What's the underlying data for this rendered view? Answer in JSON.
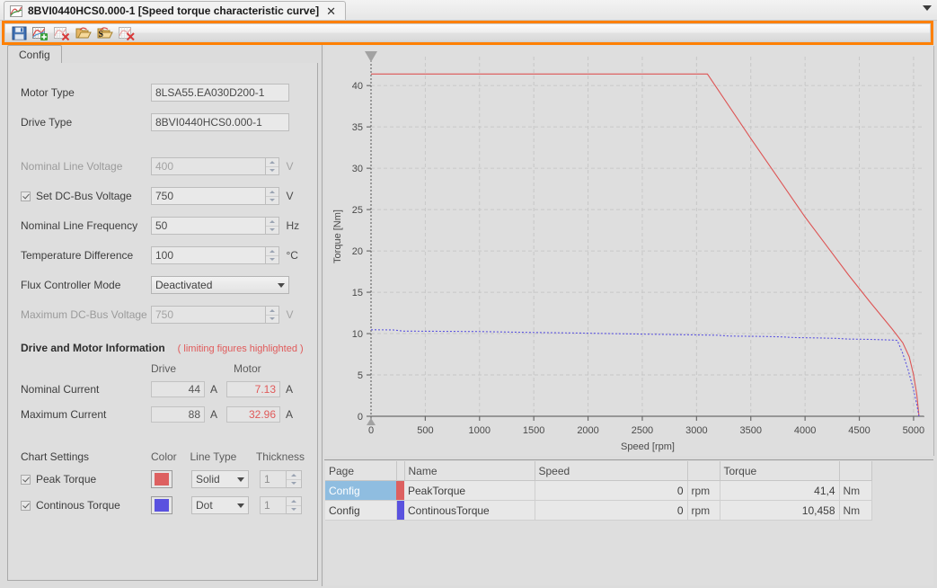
{
  "window": {
    "tab_title": "8BVI0440HCS0.000-1 [Speed torque characteristic curve]",
    "close_label": "✕",
    "tab_icon": "chart-curve-icon",
    "dropdown_icon": "chevron-down-icon",
    "accent_color": "#ff8000"
  },
  "toolbar": {
    "buttons": [
      {
        "name": "save-button",
        "icon": "floppy-disk-icon",
        "tooltip": "Save"
      },
      {
        "name": "add-curve-button",
        "icon": "chart-add-icon",
        "tooltip": "Add curve"
      },
      {
        "name": "delete-curve-button",
        "icon": "chart-delete-icon",
        "tooltip": "Delete curve"
      },
      {
        "name": "open-button",
        "icon": "open-folder-icon",
        "tooltip": "Open"
      },
      {
        "name": "save-as-button",
        "icon": "save-as-icon",
        "tooltip": "Save as"
      },
      {
        "name": "clear-chart-button",
        "icon": "chart-clear-icon",
        "tooltip": "Clear chart"
      }
    ]
  },
  "left_panel": {
    "tab_label": "Config",
    "fields": [
      {
        "label": "Motor Type",
        "value": "8LSA55.EA030D200-1",
        "type": "text",
        "unit": "",
        "disabled": false
      },
      {
        "label": "Drive Type",
        "value": "8BVI0440HCS0.000-1",
        "type": "text",
        "unit": "",
        "disabled": false
      },
      {
        "label": "Nominal Line Voltage",
        "value": "400",
        "type": "spinner",
        "unit": "V",
        "disabled": true
      },
      {
        "label": "Set DC-Bus Voltage",
        "value": "750",
        "type": "spinner",
        "unit": "V",
        "disabled": false,
        "checkbox": true,
        "checked": true
      },
      {
        "label": "Nominal Line Frequency",
        "value": "50",
        "type": "spinner",
        "unit": "Hz",
        "disabled": false
      },
      {
        "label": "Temperature Difference",
        "value": "100",
        "type": "spinner",
        "unit": "°C",
        "disabled": false
      },
      {
        "label": "Flux Controller Mode",
        "value": "Deactivated",
        "type": "select",
        "unit": "",
        "disabled": false
      },
      {
        "label": "Maximum DC-Bus Voltage",
        "value": "750",
        "type": "spinner",
        "unit": "V",
        "disabled": true
      }
    ],
    "info": {
      "title": "Drive and Motor Information",
      "note": "( limiting figures highlighted )",
      "col_drive": "Drive",
      "col_motor": "Motor",
      "rows": [
        {
          "label": "Nominal Current",
          "drive": "44",
          "drive_unit": "A",
          "motor": "7.13",
          "motor_unit": "A",
          "motor_highlight": true
        },
        {
          "label": "Maximum Current",
          "drive": "88",
          "drive_unit": "A",
          "motor": "32.96",
          "motor_unit": "A",
          "motor_highlight": true
        }
      ]
    },
    "chart_settings": {
      "title": "Chart Settings",
      "col_color": "Color",
      "col_linetype": "Line Type",
      "col_thickness": "Thickness",
      "rows": [
        {
          "label": "Peak Torque",
          "checked": true,
          "color": "#dd6060",
          "line_type": "Solid",
          "thickness": "1"
        },
        {
          "label": "Continous Torque",
          "checked": true,
          "color": "#5a52df",
          "line_type": "Dot",
          "thickness": "1"
        }
      ]
    }
  },
  "chart_data": {
    "type": "line",
    "title": "",
    "xlabel": "Speed [rpm]",
    "ylabel": "Torque [Nm]",
    "xlim": [
      0,
      5100
    ],
    "ylim": [
      0,
      43.5
    ],
    "xticks": [
      0,
      500,
      1000,
      1500,
      2000,
      2500,
      3000,
      3500,
      4000,
      4500,
      5000
    ],
    "yticks": [
      0,
      5,
      10,
      15,
      20,
      25,
      30,
      35,
      40
    ],
    "grid": true,
    "legend": "none",
    "series": [
      {
        "name": "PeakTorque",
        "color": "#dd5555",
        "style": "solid",
        "width": 1,
        "points": [
          [
            0,
            41.4
          ],
          [
            500,
            41.4
          ],
          [
            1000,
            41.4
          ],
          [
            1500,
            41.4
          ],
          [
            2000,
            41.4
          ],
          [
            2500,
            41.4
          ],
          [
            3000,
            41.4
          ],
          [
            3100,
            41.4
          ],
          [
            3300,
            37.5
          ],
          [
            3500,
            33.6
          ],
          [
            3700,
            29.8
          ],
          [
            3900,
            26.0
          ],
          [
            4000,
            24.1
          ],
          [
            4200,
            20.6
          ],
          [
            4400,
            17.1
          ],
          [
            4600,
            13.8
          ],
          [
            4800,
            10.6
          ],
          [
            4900,
            8.9
          ],
          [
            4960,
            7.2
          ],
          [
            5000,
            5.0
          ],
          [
            5030,
            2.6
          ],
          [
            5050,
            0.0
          ]
        ]
      },
      {
        "name": "ContinousTorque",
        "color": "#5a52df",
        "style": "dot",
        "width": 1,
        "points": [
          [
            0,
            10.458
          ],
          [
            200,
            10.45
          ],
          [
            300,
            10.3
          ],
          [
            600,
            10.28
          ],
          [
            1000,
            10.25
          ],
          [
            1300,
            10.18
          ],
          [
            1600,
            10.12
          ],
          [
            2000,
            10.05
          ],
          [
            2300,
            9.98
          ],
          [
            2600,
            9.92
          ],
          [
            2900,
            9.86
          ],
          [
            3200,
            9.8
          ],
          [
            3300,
            9.7
          ],
          [
            3600,
            9.66
          ],
          [
            3800,
            9.6
          ],
          [
            3900,
            9.52
          ],
          [
            4100,
            9.48
          ],
          [
            4300,
            9.42
          ],
          [
            4400,
            9.34
          ],
          [
            4600,
            9.3
          ],
          [
            4800,
            9.22
          ],
          [
            4850,
            9.18
          ],
          [
            4900,
            7.6
          ],
          [
            4950,
            5.6
          ],
          [
            5000,
            3.2
          ],
          [
            5030,
            1.4
          ],
          [
            5050,
            0.0
          ]
        ]
      }
    ]
  },
  "table": {
    "columns": [
      "Page",
      "",
      "Name",
      "Speed",
      "",
      "Torque",
      ""
    ],
    "rows": [
      {
        "page": "Config",
        "color": "#dd6060",
        "name": "PeakTorque",
        "speed": "0",
        "speed_unit": "rpm",
        "torque": "41,4",
        "torque_unit": "Nm",
        "selected": true
      },
      {
        "page": "Config",
        "color": "#5a52df",
        "name": "ContinousTorque",
        "speed": "0",
        "speed_unit": "rpm",
        "torque": "10,458",
        "torque_unit": "Nm",
        "selected": false
      }
    ]
  }
}
